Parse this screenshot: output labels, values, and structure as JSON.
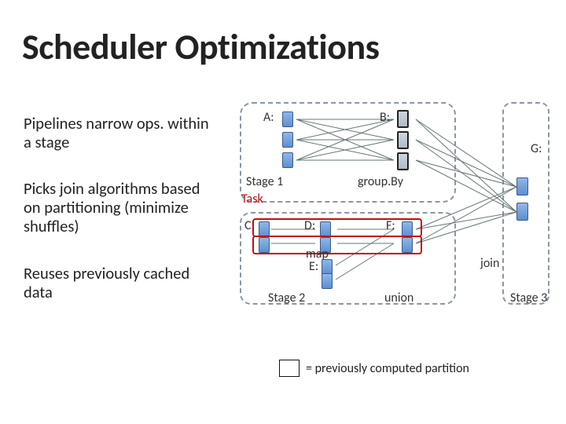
{
  "title": "Scheduler Optimizations",
  "paragraphs": {
    "p1": "Pipelines narrow ops. within a stage",
    "p2": "Picks join algorithms based on partitioning (minimize shuffles)",
    "p3": "Reuses previously cached data"
  },
  "labels": {
    "A": "A:",
    "B": "B:",
    "C": "C:",
    "D": "D:",
    "E": "E:",
    "F": "F:",
    "G": "G:",
    "stage1": "Stage 1",
    "stage2": "Stage 2",
    "stage3": "Stage 3",
    "task": "Task",
    "groupBy": "group.By",
    "map": "map",
    "join": "join",
    "union": "union"
  },
  "legend": "= previously computed partition"
}
